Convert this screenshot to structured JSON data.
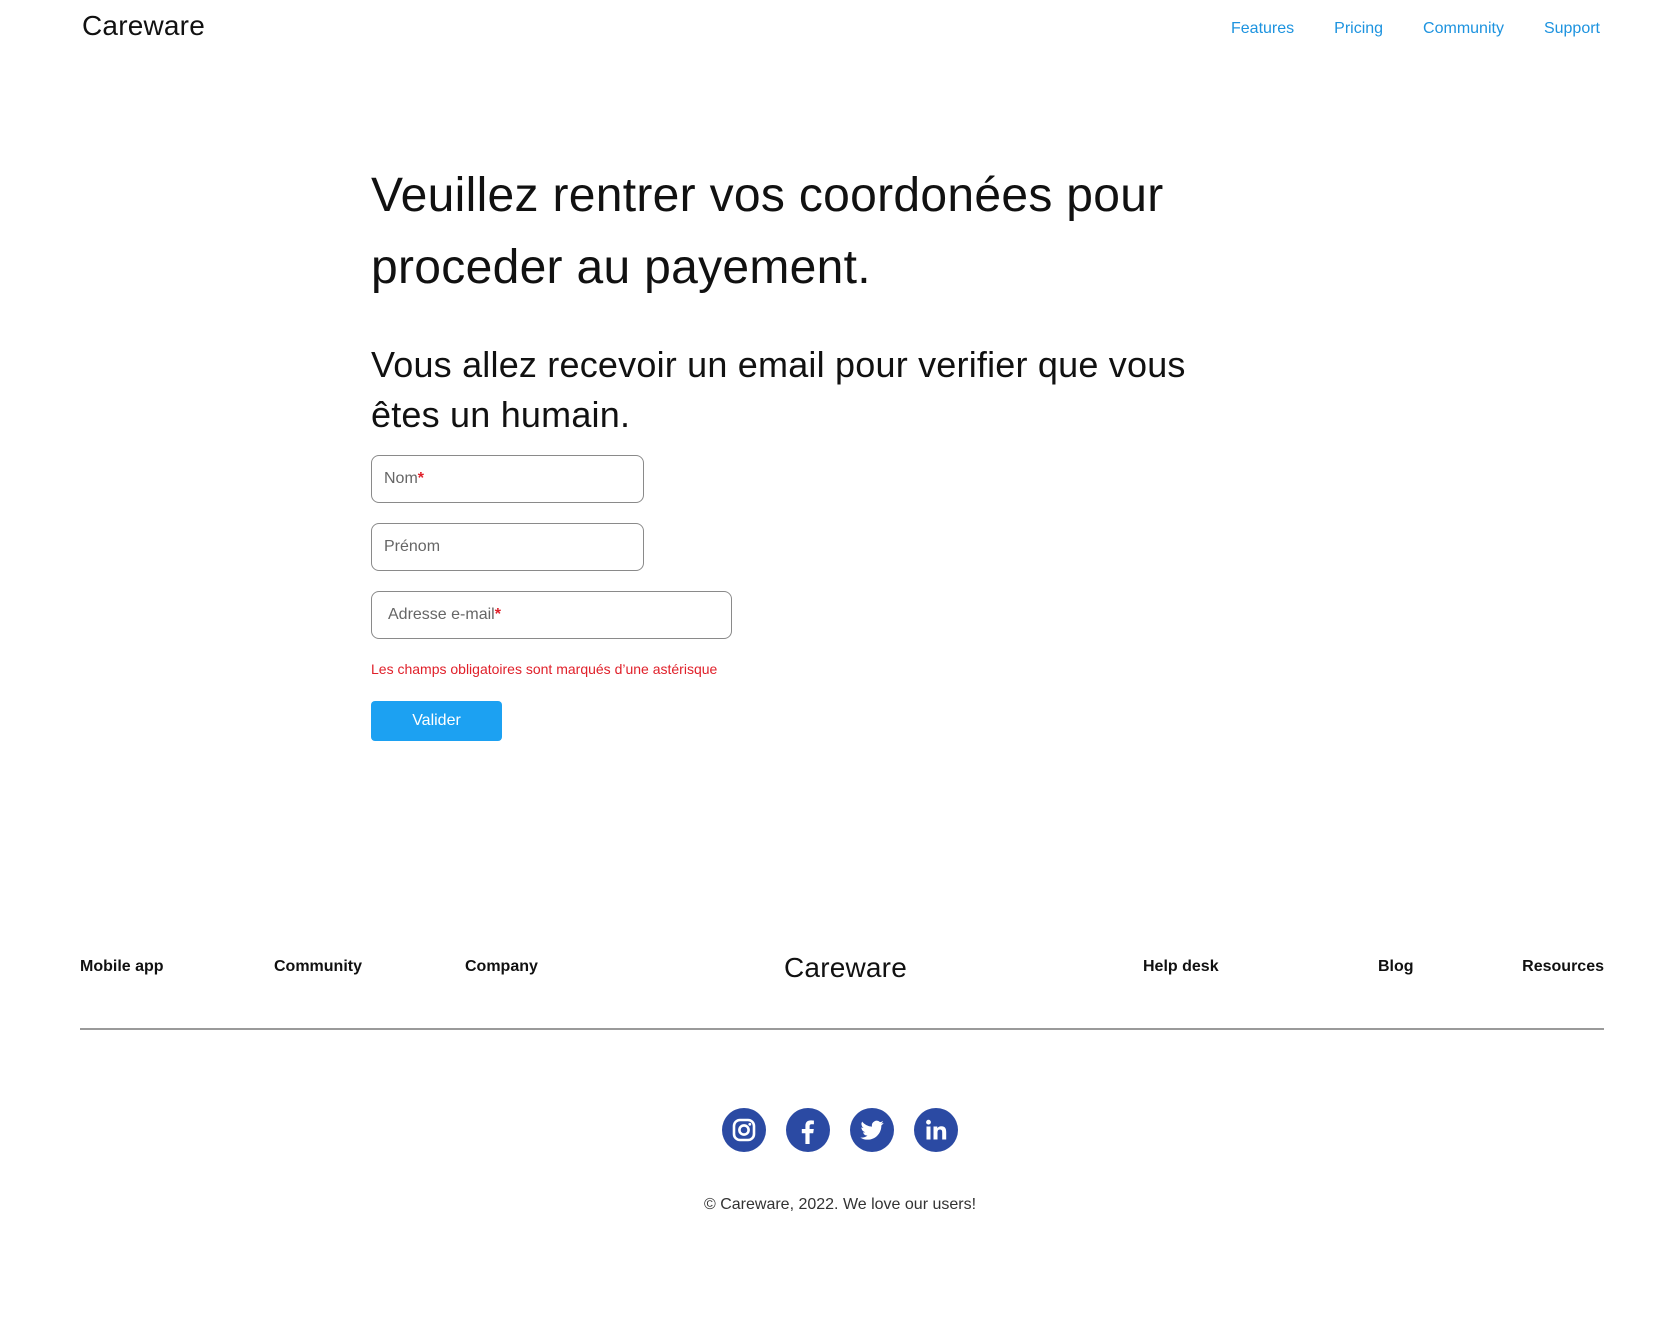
{
  "header": {
    "logo": "Careware",
    "nav": [
      "Features",
      "Pricing",
      "Community",
      "Support"
    ]
  },
  "main": {
    "title_line1": "Veuillez rentrer vos coordonées pour",
    "title_line2": "proceder au payement.",
    "subtitle_line1": "Vous allez recevoir un email pour verifier que vous",
    "subtitle_line2": "êtes un humain."
  },
  "form": {
    "nom_placeholder": "Nom",
    "prenom_placeholder": "Prénom",
    "email_placeholder": "Adresse e-mail",
    "required_marker": "*",
    "note": "Les champs obligatoires sont marqués d’une astérisque",
    "submit_label": "Valider"
  },
  "footer": {
    "links_left": [
      "Mobile app",
      "Community",
      "Company"
    ],
    "logo": "Careware",
    "links_right": [
      "Help desk",
      "Blog",
      "Resources"
    ],
    "socials": [
      "instagram-icon",
      "facebook-icon",
      "twitter-icon",
      "linkedin-icon"
    ],
    "copyright": "© Careware, 2022. We love our users!"
  },
  "colors": {
    "accent": "#1d93df",
    "button": "#1ca1f2",
    "required": "#e0202a",
    "social": "#2b4aa3"
  }
}
